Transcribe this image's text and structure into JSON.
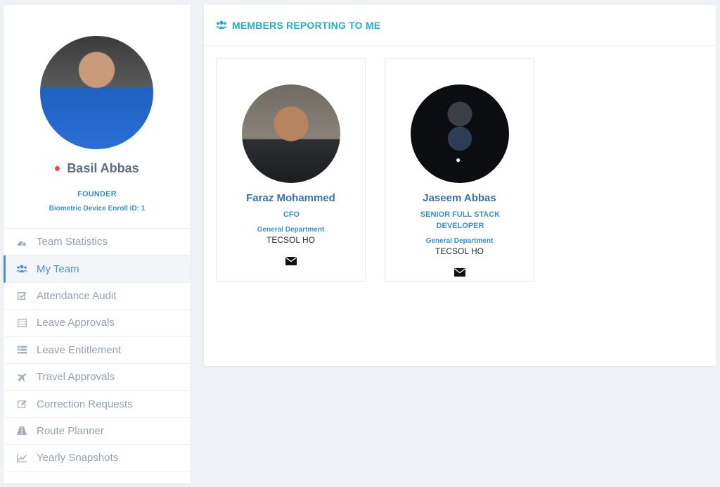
{
  "profile": {
    "name": "Basil Abbas",
    "role": "FOUNDER",
    "enroll": "Biometric Device Enroll ID: 1",
    "status_color": "#ed4b4b"
  },
  "menu": [
    {
      "label": "Team Statistics",
      "icon": "dashboard-icon"
    },
    {
      "label": "My Team",
      "icon": "users-icon",
      "active": true
    },
    {
      "label": "Attendance Audit",
      "icon": "check-square-icon"
    },
    {
      "label": "Leave Approvals",
      "icon": "calendar-icon"
    },
    {
      "label": "Leave Entitlement",
      "icon": "list-icon"
    },
    {
      "label": "Travel Approvals",
      "icon": "plane-icon"
    },
    {
      "label": "Correction Requests",
      "icon": "edit-icon"
    },
    {
      "label": "Route Planner",
      "icon": "road-icon"
    },
    {
      "label": "Yearly Snapshots",
      "icon": "line-chart-icon"
    }
  ],
  "panel": {
    "title": "MEMBERS REPORTING TO ME",
    "accent": "#1fb0c8"
  },
  "members": [
    {
      "name": "Faraz Mohammed",
      "role": "CFO",
      "department": "General Department",
      "office": "TECSOL HO"
    },
    {
      "name": "Jaseem Abbas",
      "role": "SENIOR FULL STACK DEVELOPER",
      "department": "General Department",
      "office": "TECSOL HO"
    }
  ]
}
